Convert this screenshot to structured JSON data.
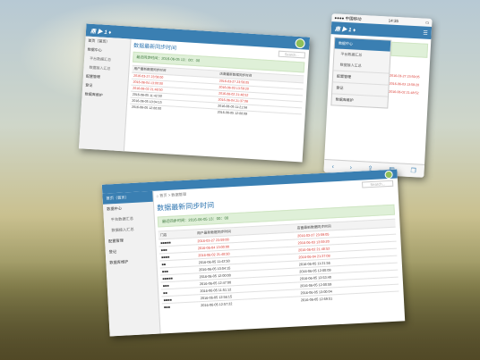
{
  "app": {
    "logo": "鼎 ▶ 1 ♦",
    "page_title": "数据最新同步时间",
    "search_placeholder": "Search..."
  },
  "breadcrumb": [
    "首页",
    "数据管理"
  ],
  "sidebar": [
    {
      "label": "首页（首页）"
    },
    {
      "label": "数据中心"
    },
    {
      "label": "平台数据汇总"
    },
    {
      "label": "数据接入汇总"
    },
    {
      "label": "配置管理"
    },
    {
      "label": "登记"
    },
    {
      "label": "数据库维护"
    }
  ],
  "alert": "最近同步时间：2016-06-05 13：00：00",
  "table": {
    "headers": [
      "门店",
      "用户最新数据同步时间",
      "店面最新数据同步时间"
    ],
    "rows": [
      {
        "name": "■■■■■",
        "t1": "2016-03-27 23:59:00",
        "t2": "2016-03-27 23:59:05",
        "red1": true,
        "red2": true
      },
      {
        "name": "■■■",
        "t1": "2016-06-04 13:00:00",
        "t2": "2016-06-03 13:59:20",
        "red1": true,
        "red2": true
      },
      {
        "name": "■■■■",
        "t1": "2016-06-02 21:48:50",
        "t2": "2016-06-02 21:48:52",
        "red1": true,
        "red2": true
      },
      {
        "name": "■■",
        "t1": "2016-06-05 11:42:50",
        "t2": "2016-06-04 21:37:08",
        "red1": false,
        "red2": true
      },
      {
        "name": "■■■",
        "t1": "2016-06-05 10:04:15",
        "t2": "2016-06-05 11:21:56",
        "red1": false,
        "red2": false
      },
      {
        "name": "■■■■■",
        "t1": "2016-06-05 12:00:00",
        "t2": "2016-06-05 12:00:09",
        "red1": false,
        "red2": false
      },
      {
        "name": "■■■",
        "t1": "2016-06-05 12:47:00",
        "t2": "2016-06-05 12:53:40",
        "red1": false,
        "red2": false
      },
      {
        "name": "■■",
        "t1": "2016-06-05 11:51:12",
        "t2": "2016-06-05 12:00:59",
        "red1": false,
        "red2": false
      },
      {
        "name": "■■■■",
        "t1": "2016-06-05 12:56:15",
        "t2": "2016-06-05 13:00:04",
        "red1": false,
        "red2": false
      },
      {
        "name": "■■■",
        "t1": "2016-06-05 12:57:22",
        "t2": "2016-06-05 12:59:51",
        "red1": false,
        "red2": false
      }
    ]
  },
  "mobile": {
    "status": "●●●● 中国移动",
    "clock": "14:35",
    "rows": [
      {
        "t": "2016-03-27 23:59:05"
      },
      {
        "t": "2016-06-03 13:59:20"
      },
      {
        "t": "2016-06-02 21:48:52"
      }
    ]
  }
}
